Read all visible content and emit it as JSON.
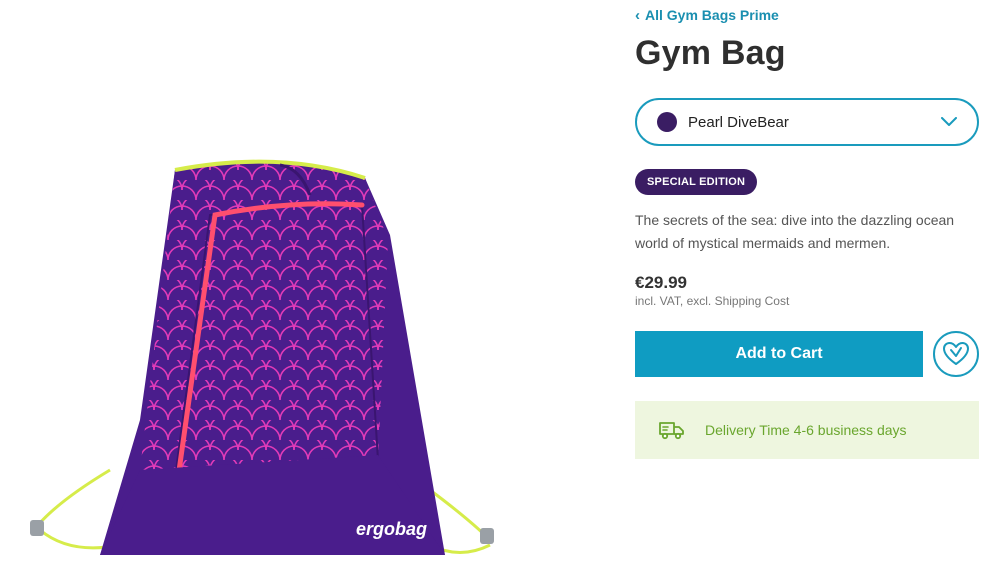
{
  "breadcrumb": {
    "label": "All Gym Bags Prime",
    "icon": "chevron-left-icon"
  },
  "product": {
    "title": "Gym Bag",
    "variant": {
      "label": "Pearl DiveBear",
      "swatch_color": "#3a1d63"
    },
    "badge": "SPECIAL EDITION",
    "description": "The secrets of the sea: dive into the dazzling ocean world of mystical mermaids and mermen.",
    "price": "€29.99",
    "price_note": "incl. VAT, excl. Shipping Cost",
    "brand_on_image": "ergobag"
  },
  "actions": {
    "add_to_cart": "Add to Cart",
    "wishlist_icon": "heart-icon"
  },
  "delivery": {
    "text": "Delivery Time 4-6 business days",
    "icon": "truck-icon"
  },
  "colors": {
    "accent": "#0f9cc2",
    "badge": "#3a1d63",
    "delivery_bg": "#eef6df",
    "delivery_text": "#6aa62e"
  }
}
